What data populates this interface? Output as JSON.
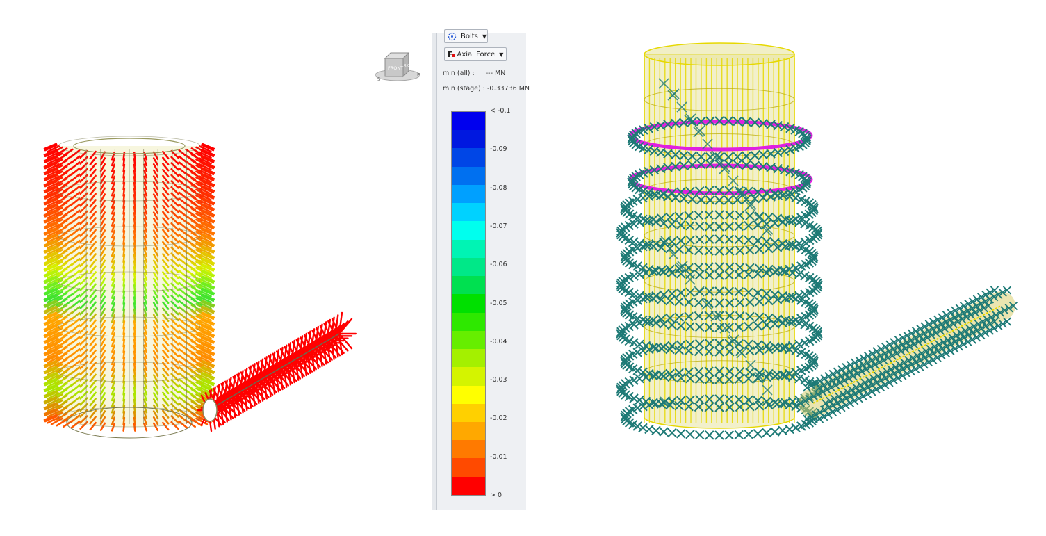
{
  "panel": {
    "result_set": {
      "label": "Bolts"
    },
    "quantity": {
      "label": "Axial Force",
      "icon_text": "F"
    },
    "stats": [
      {
        "label": "min (all) :",
        "value": "--- MN"
      },
      {
        "label": "min (stage) :",
        "value": "-0.33736 MN"
      }
    ],
    "legend": {
      "ticks": [
        "< -0.1",
        "-0.09",
        "-0.08",
        "-0.07",
        "-0.06",
        "-0.05",
        "-0.04",
        "-0.03",
        "-0.02",
        "-0.01",
        "> 0"
      ],
      "colors": [
        "#0000ee",
        "#0018e0",
        "#0046e6",
        "#0070f0",
        "#00a0ff",
        "#00d2ff",
        "#00ffee",
        "#00f4b4",
        "#00e888",
        "#00e050",
        "#00e000",
        "#2ee800",
        "#66ee00",
        "#a4f000",
        "#d4f400",
        "#ffff00",
        "#ffd000",
        "#ffa800",
        "#ff7a00",
        "#ff4a00",
        "#ff0000"
      ]
    }
  },
  "viewcube": {
    "front_label": "FRONT",
    "right_label": "RIGHT",
    "south_label": "S",
    "east_label": "E"
  },
  "colors": {
    "shaft_fill": "#e8e4a0",
    "bolt_rings": "#1e7a76",
    "magenta_struts": "#e020e0",
    "yellow_liners": "#e6d800"
  }
}
